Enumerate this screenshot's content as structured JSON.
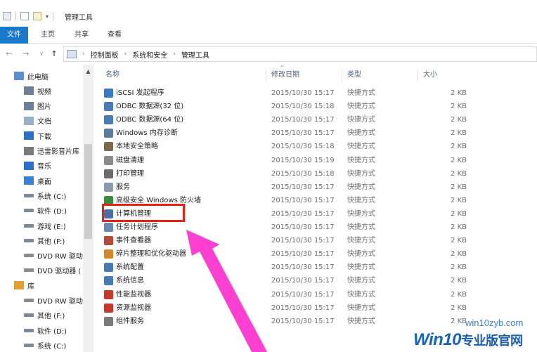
{
  "window": {
    "title": "管理工具"
  },
  "ribbon": {
    "tabs": [
      {
        "label": "文件"
      },
      {
        "label": "主页"
      },
      {
        "label": "共享"
      },
      {
        "label": "查看"
      }
    ]
  },
  "nav": {
    "back_icon": "back-arrow-icon",
    "forward_icon": "forward-arrow-icon",
    "recent_icon": "chevron-down-icon",
    "up_icon": "up-arrow-icon",
    "breadcrumbs": [
      "控制面板",
      "系统和安全",
      "管理工具"
    ]
  },
  "sidebar": {
    "items": [
      {
        "label": "此电脑",
        "icon": "computer-icon"
      },
      {
        "label": "视频",
        "icon": "video-folder-icon"
      },
      {
        "label": "图片",
        "icon": "pictures-folder-icon"
      },
      {
        "label": "文档",
        "icon": "documents-folder-icon"
      },
      {
        "label": "下载",
        "icon": "download-folder-icon"
      },
      {
        "label": "迅雷影音片库",
        "icon": "media-library-icon"
      },
      {
        "label": "音乐",
        "icon": "music-folder-icon"
      },
      {
        "label": "桌面",
        "icon": "desktop-folder-icon"
      },
      {
        "label": "系统 (C:)",
        "icon": "drive-icon"
      },
      {
        "label": "软件 (D:)",
        "icon": "drive-icon"
      },
      {
        "label": "游戏 (E:)",
        "icon": "drive-icon"
      },
      {
        "label": "其他 (F:)",
        "icon": "drive-icon"
      },
      {
        "label": "DVD RW 驱动",
        "icon": "dvd-drive-icon"
      },
      {
        "label": "DVD 驱动器 (",
        "icon": "dvd-drive-icon"
      },
      {
        "label": "库",
        "icon": "library-icon"
      },
      {
        "label": "DVD RW 驱动器",
        "icon": "dvd-drive-icon"
      },
      {
        "label": "其他 (F:)",
        "icon": "drive-icon"
      },
      {
        "label": "软件 (D:)",
        "icon": "drive-icon"
      },
      {
        "label": "系统 (C:)",
        "icon": "drive-icon"
      }
    ]
  },
  "columns": {
    "name": "名称",
    "date": "修改日期",
    "type": "类型",
    "size": "大小"
  },
  "files": [
    {
      "name": "iSCSI 发起程序",
      "date": "2015/10/30 15:17",
      "type": "快捷方式",
      "size": "2 KB",
      "icon": "iscsi-icon",
      "color": "#3a78c2"
    },
    {
      "name": "ODBC 数据源(32 位)",
      "date": "2015/10/30 15:18",
      "type": "快捷方式",
      "size": "2 KB",
      "icon": "odbc-icon",
      "color": "#4a7bb3"
    },
    {
      "name": "ODBC 数据源(64 位)",
      "date": "2015/10/30 15:17",
      "type": "快捷方式",
      "size": "2 KB",
      "icon": "odbc-icon",
      "color": "#4a7bb3"
    },
    {
      "name": "Windows 内存诊断",
      "date": "2015/10/30 15:17",
      "type": "快捷方式",
      "size": "2 KB",
      "icon": "memory-diagnostic-icon",
      "color": "#5c7a99"
    },
    {
      "name": "本地安全策略",
      "date": "2015/10/30 15:18",
      "type": "快捷方式",
      "size": "2 KB",
      "icon": "security-policy-icon",
      "color": "#7a6a4a"
    },
    {
      "name": "磁盘清理",
      "date": "2015/10/30 15:19",
      "type": "快捷方式",
      "size": "2 KB",
      "icon": "disk-cleanup-icon",
      "color": "#8a8a8a"
    },
    {
      "name": "打印管理",
      "date": "2015/10/30 15:18",
      "type": "快捷方式",
      "size": "2 KB",
      "icon": "printer-icon",
      "color": "#6b6b6b"
    },
    {
      "name": "服务",
      "date": "2015/10/30 15:17",
      "type": "快捷方式",
      "size": "2 KB",
      "icon": "services-gear-icon",
      "color": "#8a9aa8"
    },
    {
      "name": "高级安全 Windows 防火墙",
      "date": "2015/10/30 15:17",
      "type": "快捷方式",
      "size": "2 KB",
      "icon": "firewall-icon",
      "color": "#3c8a3c"
    },
    {
      "name": "计算机管理",
      "date": "2015/10/30 15:17",
      "type": "快捷方式",
      "size": "2 KB",
      "icon": "computer-management-icon",
      "color": "#4a6fa5"
    },
    {
      "name": "任务计划程序",
      "date": "2015/10/30 15:17",
      "type": "快捷方式",
      "size": "2 KB",
      "icon": "task-scheduler-icon",
      "color": "#6a8ab0"
    },
    {
      "name": "事件查看器",
      "date": "2015/10/30 15:17",
      "type": "快捷方式",
      "size": "2 KB",
      "icon": "event-viewer-icon",
      "color": "#b04a3a"
    },
    {
      "name": "碎片整理和优化驱动器",
      "date": "2015/10/30 15:17",
      "type": "快捷方式",
      "size": "2 KB",
      "icon": "defrag-icon",
      "color": "#d08a2a"
    },
    {
      "name": "系统配置",
      "date": "2015/10/30 15:17",
      "type": "快捷方式",
      "size": "2 KB",
      "icon": "system-config-icon",
      "color": "#4a78b0"
    },
    {
      "name": "系统信息",
      "date": "2015/10/30 15:17",
      "type": "快捷方式",
      "size": "2 KB",
      "icon": "system-info-icon",
      "color": "#4a78b0"
    },
    {
      "name": "性能监视器",
      "date": "2015/10/30 15:17",
      "type": "快捷方式",
      "size": "2 KB",
      "icon": "performance-monitor-icon",
      "color": "#c0392b"
    },
    {
      "name": "资源监视器",
      "date": "2015/10/30 15:17",
      "type": "快捷方式",
      "size": "2 KB",
      "icon": "resource-monitor-icon",
      "color": "#c0392b"
    },
    {
      "name": "组件服务",
      "date": "2015/10/30 15:17",
      "type": "快捷方式",
      "size": "2 KB",
      "icon": "component-services-icon",
      "color": "#7a7a7a"
    }
  ],
  "annotation": {
    "highlight_color": "#e62117",
    "arrow_color": "#ff3fd2"
  },
  "watermark": {
    "url": "win10zyb.com",
    "brand": "Win10",
    "brand_cn": "专业版官网"
  }
}
